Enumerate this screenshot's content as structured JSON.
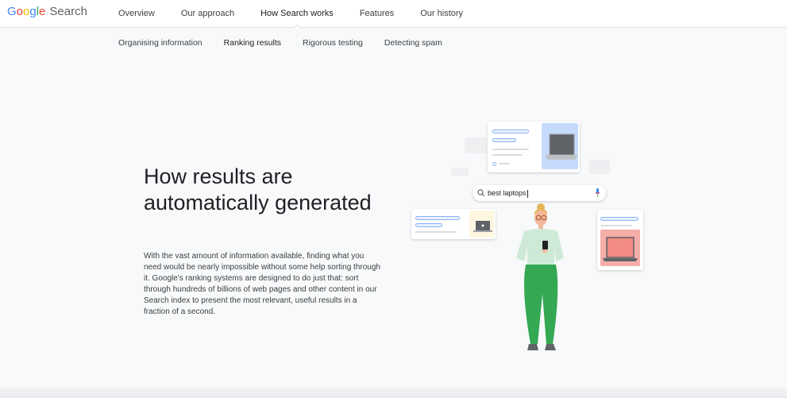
{
  "header": {
    "logo_letters": [
      {
        "ch": "G",
        "color": "#4285F4"
      },
      {
        "ch": "o",
        "color": "#EA4335"
      },
      {
        "ch": "o",
        "color": "#FBBC05"
      },
      {
        "ch": "g",
        "color": "#4285F4"
      },
      {
        "ch": "l",
        "color": "#34A853"
      },
      {
        "ch": "e",
        "color": "#EA4335"
      }
    ],
    "product": "Search",
    "nav": [
      {
        "label": "Overview",
        "active": false
      },
      {
        "label": "Our approach",
        "active": false
      },
      {
        "label": "How Search works",
        "active": true
      },
      {
        "label": "Features",
        "active": false
      },
      {
        "label": "Our history",
        "active": false
      }
    ]
  },
  "subnav": [
    {
      "label": "Organising information",
      "active": false
    },
    {
      "label": "Ranking results",
      "active": true
    },
    {
      "label": "Rigorous testing",
      "active": false
    },
    {
      "label": "Detecting spam",
      "active": false
    }
  ],
  "hero": {
    "headline": "How results are automatically generated",
    "body": "With the vast amount of information available, finding what you need would be nearly impossible without some help sorting through it. Google's ranking systems are designed to do just that: sort through hundreds of billions of web pages and other content in our Search index to present the most relevant, useful results in a fraction of a second."
  },
  "illustration": {
    "search_query": "best laptops",
    "search_icon": "search-icon",
    "mic_icon": "mic-icon",
    "colors": {
      "accent_blue": "#4285F4",
      "pill_border": "#8ab4f8",
      "card_blue_bg": "#c6dafc",
      "card_yellow_bg": "#fef7e0",
      "card_pink_bg": "#f6aea9",
      "laptop_dark": "#5f6368",
      "shirt": "#ceead6",
      "pants": "#34A853"
    }
  }
}
